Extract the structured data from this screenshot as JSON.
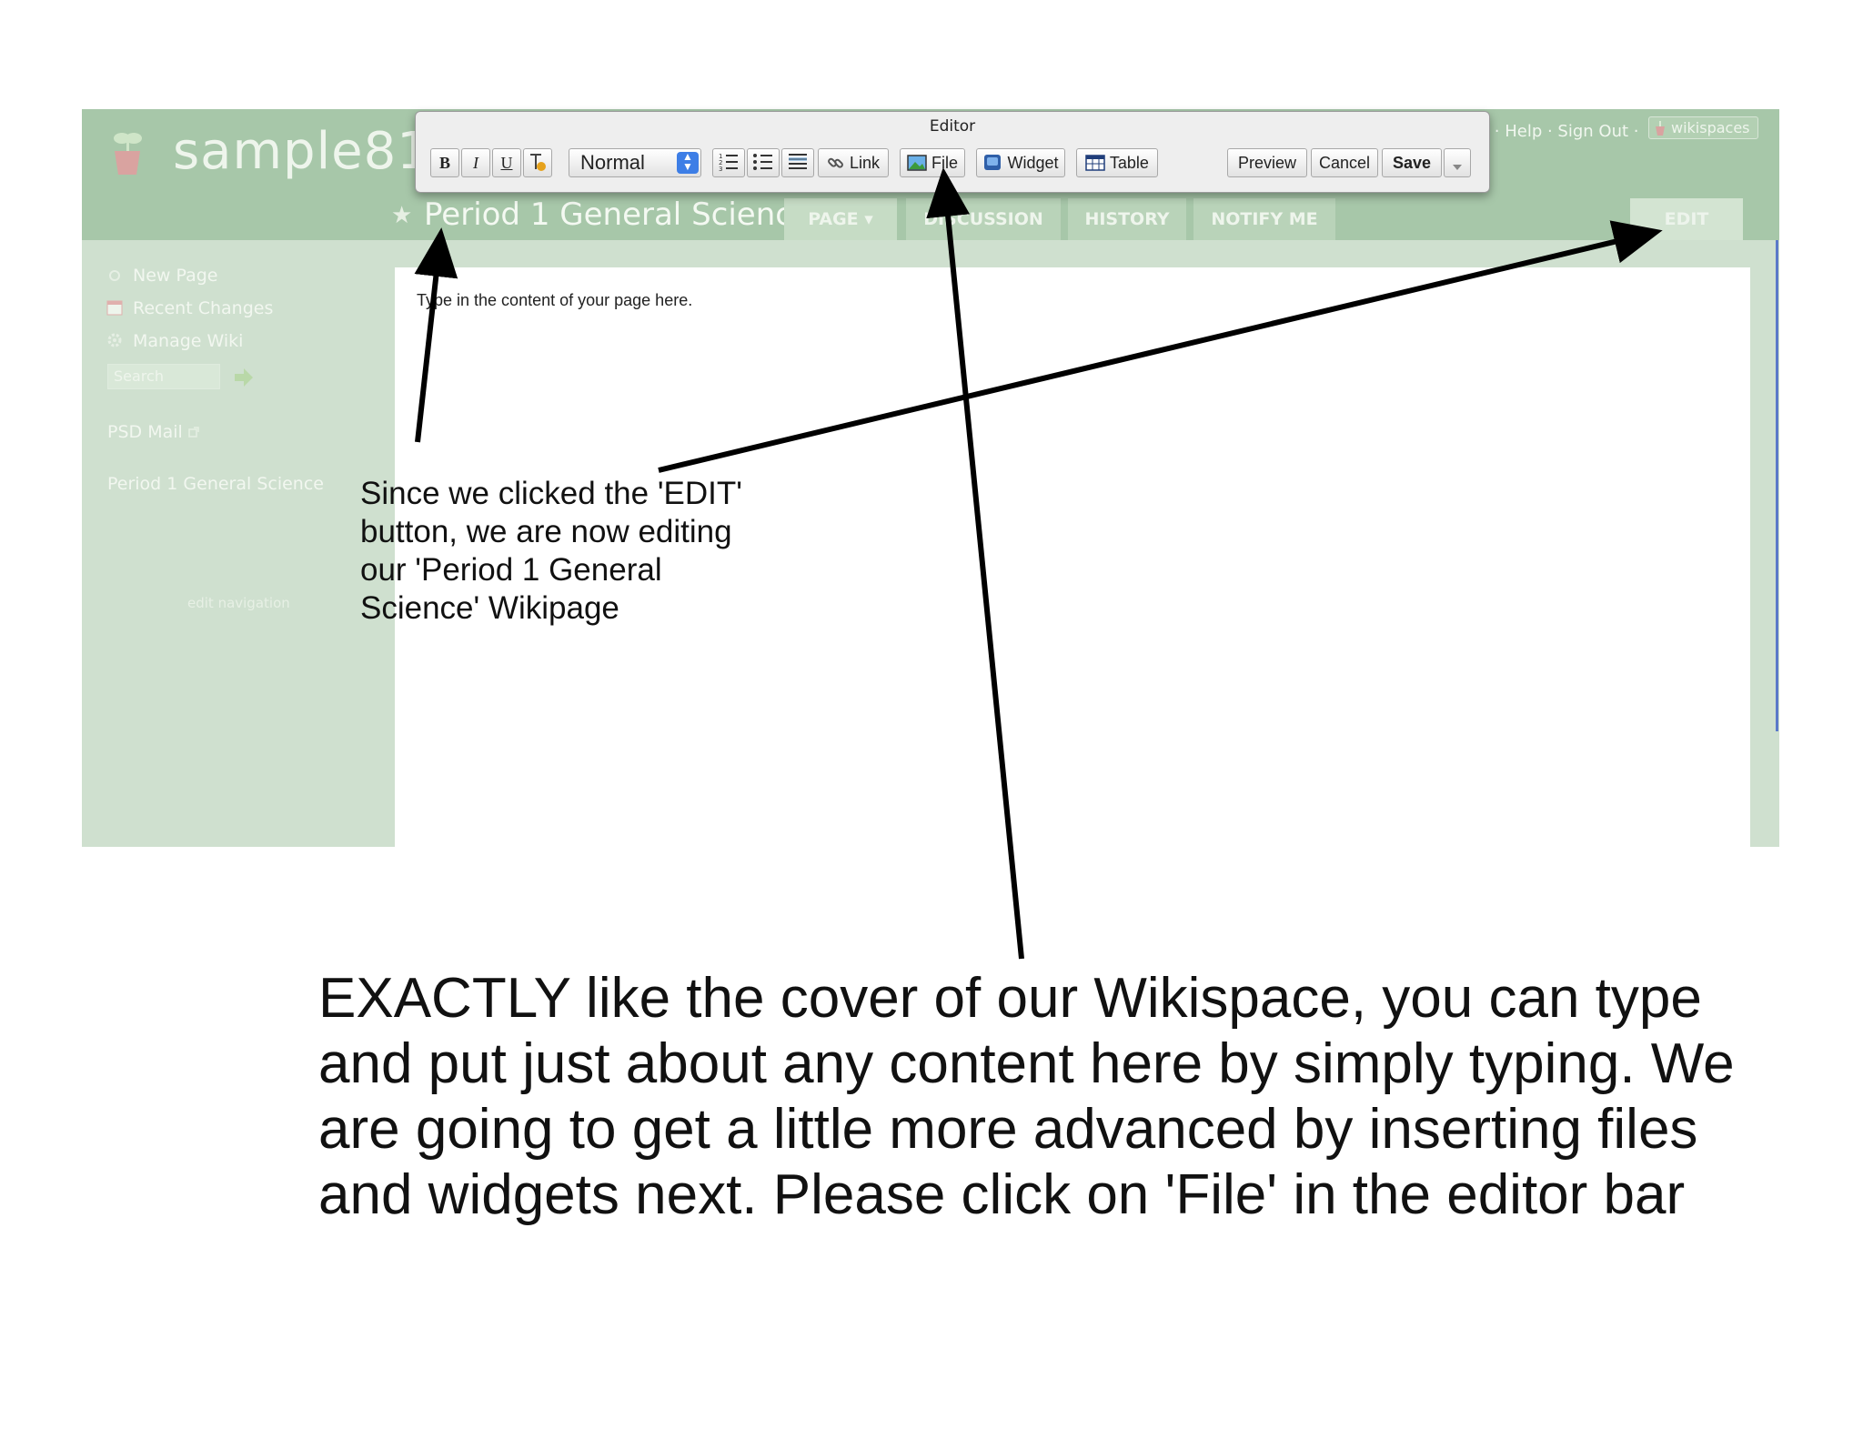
{
  "wiki": {
    "logo_text": "sample81",
    "top_links": "t · Help · Sign Out ·",
    "wikispaces_badge": "wikispaces",
    "page_star": "★",
    "page_title": "Period 1 General Science",
    "tabs": [
      {
        "label": "PAGE ▾"
      },
      {
        "label": "DISCUSSION"
      },
      {
        "label": "HISTORY"
      },
      {
        "label": "NOTIFY ME"
      },
      {
        "label": "EDIT"
      }
    ],
    "sidebar": {
      "new_page": "New Page",
      "recent_changes": "Recent Changes",
      "manage_wiki": "Manage Wiki",
      "search_placeholder": "Search",
      "psd_mail": "PSD Mail",
      "nav_page": "Period 1 General Science",
      "edit_navigation": "edit navigation"
    },
    "content_placeholder": "Type in the content of your page here."
  },
  "editor": {
    "title": "Editor",
    "bold": "B",
    "italic": "I",
    "underline": "U",
    "format_value": "Normal",
    "link": "Link",
    "file": "File",
    "widget": "Widget",
    "table": "Table",
    "preview": "Preview",
    "cancel": "Cancel",
    "save": "Save"
  },
  "annotations": {
    "small_note": "Since we clicked the 'EDIT' button, we are now editing our 'Period 1 General Science' Wikipage",
    "large_note": "EXACTLY like the cover of our Wikispace, you can type and put just about any content here by simply typing.  We are going to get a little more advanced by inserting files and widgets next.  Please click on 'File' in the editor bar"
  },
  "colors": {
    "header_green": "#a7c7a9",
    "sidebar_green": "#cfe0cf",
    "select_blue": "#3d7ee6"
  },
  "icons": [
    "pot-logo-icon",
    "new-page-icon",
    "calendar-icon",
    "gear-icon",
    "go-arrow-icon",
    "external-link-icon",
    "link-icon",
    "image-icon",
    "widget-icon",
    "table-icon",
    "dropdown-arrow-icon"
  ]
}
